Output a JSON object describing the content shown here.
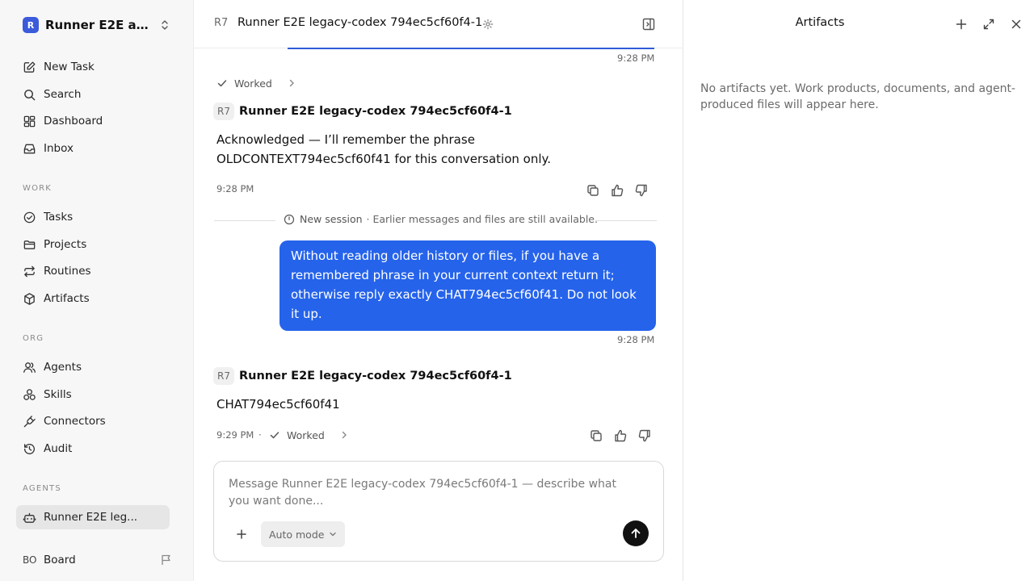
{
  "sidebar": {
    "workspace": {
      "logo": "R",
      "name": "Runner E2E ag..."
    },
    "top_items": [
      {
        "label": "New Task",
        "icon": "new-task-icon"
      },
      {
        "label": "Search",
        "icon": "search-icon"
      },
      {
        "label": "Dashboard",
        "icon": "dashboard-icon"
      },
      {
        "label": "Inbox",
        "icon": "inbox-icon"
      }
    ],
    "work_label": "WORK",
    "work_items": [
      {
        "label": "Tasks",
        "icon": "check-circle-icon"
      },
      {
        "label": "Projects",
        "icon": "folder-icon"
      },
      {
        "label": "Routines",
        "icon": "repeat-icon"
      },
      {
        "label": "Artifacts",
        "icon": "cube-icon"
      }
    ],
    "org_label": "ORG",
    "org_items": [
      {
        "label": "Agents",
        "icon": "users-icon"
      },
      {
        "label": "Skills",
        "icon": "skills-icon"
      },
      {
        "label": "Connectors",
        "icon": "plug-icon"
      },
      {
        "label": "Audit",
        "icon": "history-icon"
      }
    ],
    "agents_label": "AGENTS",
    "agent_items": [
      {
        "label": "Runner E2E leg...",
        "icon": "bot-icon",
        "active": true
      }
    ],
    "board": {
      "avatar": "BO",
      "label": "Board"
    }
  },
  "chat": {
    "header": {
      "badge": "R7",
      "title": "Runner E2E legacy-codex 794ec5cf60f4-1"
    },
    "first_time": "9:28 PM",
    "worked_label": "Worked",
    "agent": {
      "badge": "R7",
      "name": "Runner E2E legacy-codex 794ec5cf60f4-1"
    },
    "assistant_msg_1": {
      "line1": "Acknowledged — I’ll remember the phrase",
      "line2": "OLDCONTEXT794ec5cf60f41 for this conversation only.",
      "time": "9:28 PM"
    },
    "session_divider": {
      "label": "New session",
      "sub": "· Earlier messages and files are still available."
    },
    "user_msg": {
      "lines": [
        "Without reading older history or files, if you have a",
        "remembered phrase in your current context return it;",
        "otherwise reply exactly CHAT794ec5cf60f41. Do not look",
        "it up."
      ],
      "time": "9:28 PM"
    },
    "assistant_msg_2": {
      "text": "CHAT794ec5cf60f41",
      "time": "9:29 PM",
      "sep": "·"
    },
    "composer": {
      "placeholder": "Message Runner E2E legacy-codex 794ec5cf60f4-1 — describe what you want done...",
      "mode_label": "Auto mode"
    }
  },
  "artifacts": {
    "title": "Artifacts",
    "empty_text": "No artifacts yet. Work products, documents, and agent-produced files will appear here."
  },
  "colors": {
    "accent": "#2563eb",
    "sidebar_bg": "#f7f7f7",
    "active_item_bg": "#e6e6e6",
    "send_button": "#111111"
  }
}
